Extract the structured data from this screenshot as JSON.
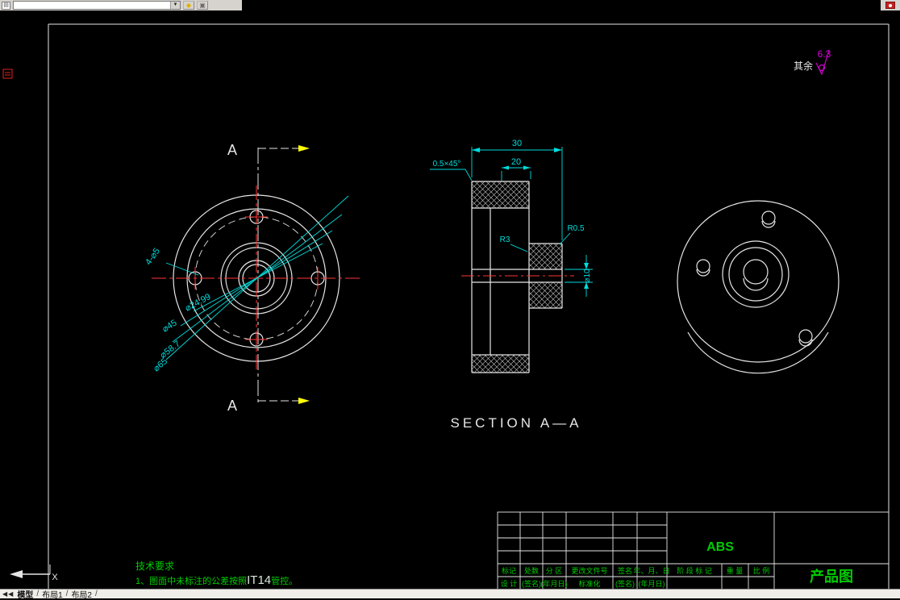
{
  "toolbar": {
    "combo_value": "",
    "icons": {
      "doc": "▤",
      "dropdown": "▼",
      "diamond": "◆",
      "cube": "▣"
    }
  },
  "canvas": {
    "surface": {
      "prefix": "其余",
      "value": "6.3"
    },
    "front": {
      "letter_top": "A",
      "letter_bottom": "A",
      "dims": {
        "d1": "⌀24.99",
        "d2": "⌀45",
        "d3": "⌀58.7",
        "d4": "⌀65",
        "holes": "4-⌀5"
      }
    },
    "section": {
      "title": "SECTION A—A",
      "w30": "30",
      "w20": "20",
      "chamfer": "0.5×45°",
      "r3": "R3",
      "r05": "R0.5",
      "d10": "⌀10"
    },
    "tech": {
      "heading": "技术要求",
      "prefix": "1、图面中未标注的公差按照",
      "code": "IT14",
      "suffix": "管控。"
    },
    "ucs_label": "X"
  },
  "title_block": {
    "material": "ABS",
    "name": "产品图",
    "row1": [
      "标记",
      "处数",
      "分 区",
      "更改文件号",
      "签名",
      "年、月、日"
    ],
    "row2": [
      "设 计",
      "(签名)",
      "(年月日)",
      "标准化",
      "(签名)",
      "(年月日)"
    ],
    "mid": [
      "阶 段 标 记",
      "重 量",
      "比 例"
    ]
  },
  "tabs": {
    "nav": "◀◀",
    "items": [
      "模型",
      "布局1",
      "布局2"
    ],
    "sep": "/"
  }
}
